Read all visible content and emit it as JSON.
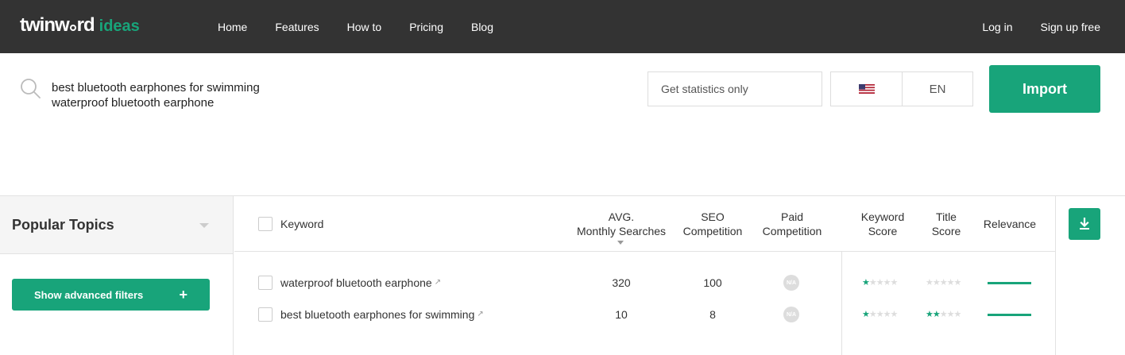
{
  "app": {
    "brand": "twinw",
    "brand_suffix": "rd",
    "product": "ideas"
  },
  "nav": {
    "left": [
      "Home",
      "Features",
      "How to",
      "Pricing",
      "Blog"
    ],
    "right": [
      "Log in",
      "Sign up free"
    ]
  },
  "search": {
    "text": "best bluetooth earphones for swimming\nwaterproof bluetooth earphone",
    "stats_placeholder": "Get statistics only",
    "language_code": "EN",
    "country_flag": "us-flag-icon",
    "import_label": "Import"
  },
  "sidebar": {
    "title": "Popular Topics",
    "advanced_filters_label": "Show advanced filters",
    "advanced_filters_plus": "+"
  },
  "table": {
    "headers": {
      "keyword": "Keyword",
      "avg_line1": "AVG.",
      "avg_line2": "Monthly Searches",
      "seo_line1": "SEO",
      "seo_line2": "Competition",
      "paid_line1": "Paid",
      "paid_line2": "Competition",
      "kscore_line1": "Keyword",
      "kscore_line2": "Score",
      "tscore_line1": "Title",
      "tscore_line2": "Score",
      "relevance": "Relevance"
    },
    "rows": [
      {
        "keyword": "waterproof bluetooth earphone",
        "avg": "320",
        "seo": "100",
        "paid": "N/A",
        "keyword_score": 1,
        "title_score": 0,
        "relevance": 1.0
      },
      {
        "keyword": "best bluetooth earphones for swimming",
        "avg": "10",
        "seo": "8",
        "paid": "N/A",
        "keyword_score": 1,
        "title_score": 2,
        "relevance": 1.0
      }
    ]
  },
  "colors": {
    "accent": "#18a47a",
    "topbar": "#333333"
  }
}
